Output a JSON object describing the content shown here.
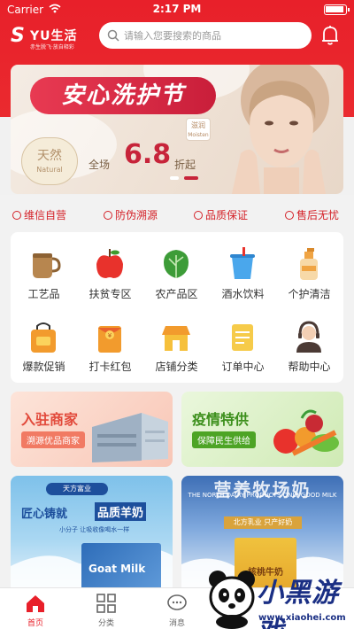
{
  "status_bar": {
    "carrier": "Carrier",
    "time": "2:17 PM"
  },
  "header": {
    "logo_brand": "YU生活",
    "logo_slogan": "赤生脱飞·放自释彩",
    "search_placeholder": "请输入您要搜索的商品"
  },
  "banner": {
    "title": "安心洗护节",
    "tag_cn": "天然",
    "tag_en": "Natural",
    "promo_prefix": "全场",
    "promo_number": "6.8",
    "promo_suffix": "折起",
    "product_cn": "滋润",
    "product_en": "Moisten"
  },
  "assurances": [
    "维信自营",
    "防伪溯源",
    "品质保证",
    "售后无忧"
  ],
  "categories": [
    {
      "label": "工艺品",
      "icon": "handicraft-icon"
    },
    {
      "label": "扶贫专区",
      "icon": "apple-icon"
    },
    {
      "label": "农产品区",
      "icon": "vegetable-icon"
    },
    {
      "label": "酒水饮料",
      "icon": "drink-icon"
    },
    {
      "label": "个护清洁",
      "icon": "cleaner-bottle-icon"
    },
    {
      "label": "爆款促销",
      "icon": "promo-bag-icon"
    },
    {
      "label": "打卡红包",
      "icon": "red-packet-icon"
    },
    {
      "label": "店铺分类",
      "icon": "shop-icon"
    },
    {
      "label": "订单中心",
      "icon": "order-note-icon"
    },
    {
      "label": "帮助中心",
      "icon": "support-agent-icon"
    }
  ],
  "promos": {
    "merchant_title": "入驻商家",
    "merchant_sub": "溯源优品商家",
    "epidemic_title": "疫情特供",
    "epidemic_sub": "保障民生供给"
  },
  "goods": {
    "left_badge": "天方富业",
    "left_line1": "匠心铸就",
    "left_line2": "品质羊奶",
    "left_line3": "小分子 让吸收像喝水一样",
    "left_box": "Goat Milk",
    "right_big": "营养牧场奶",
    "right_en": "THE NORTH DAIRY PRODUCTS ONLY GOOD MILK",
    "right_band": "北方乳业 只产好奶",
    "right_pack": "核桃牛奶"
  },
  "tabbar": [
    {
      "label": "首页",
      "icon": "home-icon",
      "active": true
    },
    {
      "label": "分类",
      "icon": "category-grid-icon",
      "active": false
    },
    {
      "label": "消息",
      "icon": "message-icon",
      "active": false
    }
  ],
  "watermark": {
    "word": "小黑游戏",
    "url": "www.xiaohei.com"
  },
  "colors": {
    "brand_red": "#e8202a",
    "assure_red": "#d42128"
  }
}
